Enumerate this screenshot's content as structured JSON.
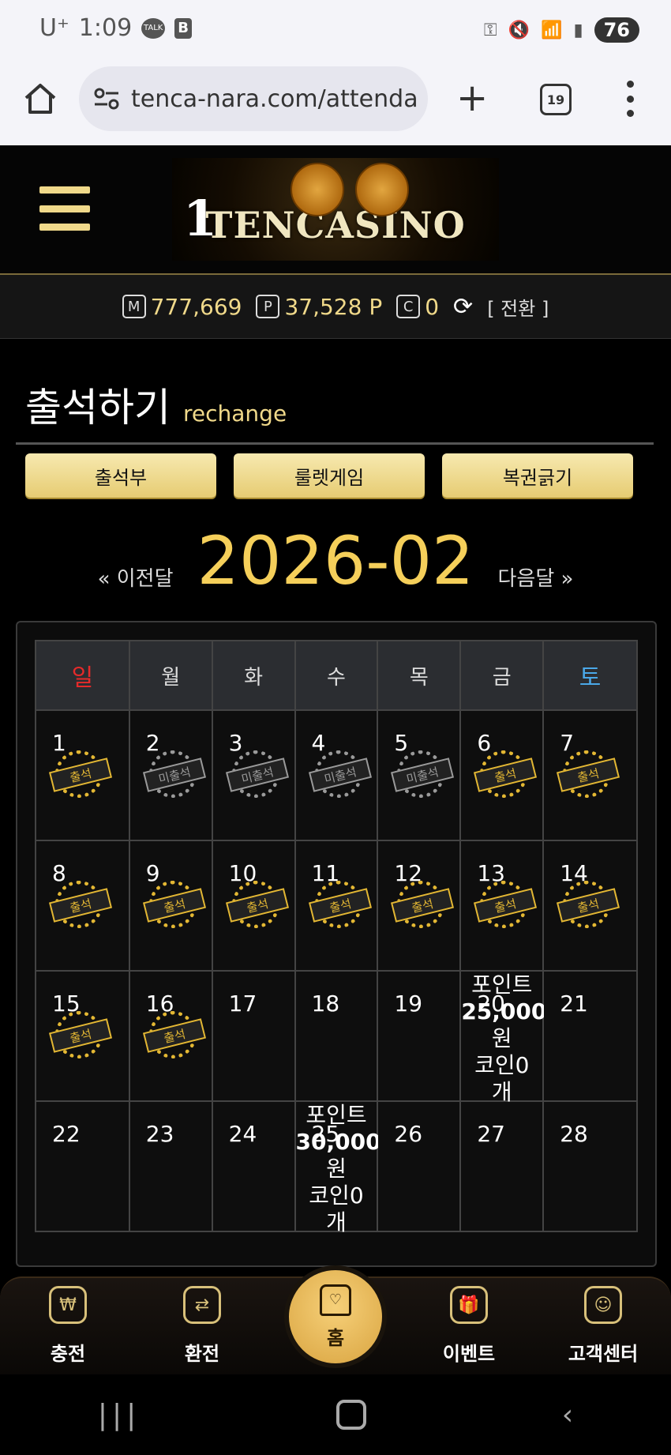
{
  "status_bar": {
    "carrier": "U⁺",
    "time": "1:09",
    "talk_badge": "TALK",
    "b_badge": "B",
    "battery": "76"
  },
  "browser": {
    "url": "tenca-nara.com/attenda",
    "tab_count": "19"
  },
  "site": {
    "logo_text": "TENCASINO",
    "logo_digit": "1"
  },
  "wallet": {
    "money_icon": "M",
    "money": "777,669",
    "point_icon": "P",
    "points": "37,528 P",
    "coin_icon": "C",
    "coins": "0",
    "switch_label": "[ 전환 ]"
  },
  "page": {
    "title": "출석하기",
    "subtitle": "rechange"
  },
  "buttons": {
    "attendance": "출석부",
    "roulette": "룰렛게임",
    "lottery": "복권긁기"
  },
  "month_nav": {
    "prev": "« 이전달",
    "current": "2026-02",
    "next": "다음달 »"
  },
  "calendar": {
    "weekdays": [
      "일",
      "월",
      "화",
      "수",
      "목",
      "금",
      "토"
    ],
    "stamp_on": "출석",
    "stamp_off": "미출석",
    "days": {
      "d1": "1",
      "d2": "2",
      "d3": "3",
      "d4": "4",
      "d5": "5",
      "d6": "6",
      "d7": "7",
      "d8": "8",
      "d9": "9",
      "d10": "10",
      "d11": "11",
      "d12": "12",
      "d13": "13",
      "d14": "14",
      "d15": "15",
      "d16": "16",
      "d17": "17",
      "d18": "18",
      "d19": "19",
      "d20": "20",
      "d21": "21",
      "d22": "22",
      "d23": "23",
      "d24": "24",
      "d25": "25",
      "d26": "26",
      "d27": "27",
      "d28": "28"
    },
    "reward_20": {
      "l1": "포인트",
      "l2": "25,000",
      "l3": "원",
      "l4": "코인0",
      "l5": "개"
    },
    "reward_25": {
      "l1": "포인트",
      "l2": "30,000",
      "l3": "원",
      "l4": "코인0",
      "l5": "개"
    }
  },
  "bottom_nav": {
    "charge": "충전",
    "exchange": "환전",
    "home": "홈",
    "event": "이벤트",
    "support": "고객센터"
  },
  "colors": {
    "gold": "#f5cf5a",
    "sunday": "#e62a2a",
    "saturday": "#4aa8e8"
  }
}
